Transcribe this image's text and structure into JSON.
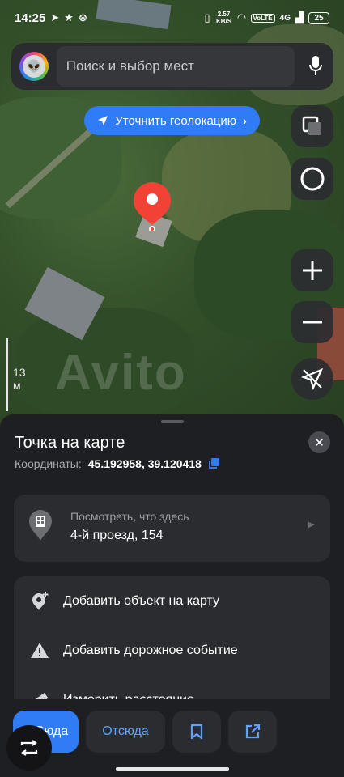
{
  "status_bar": {
    "time": "14:25",
    "net_speed": "2.57 KB/S",
    "volte": "VoLTE",
    "signal": "4G",
    "battery": "25"
  },
  "search": {
    "placeholder": "Поиск и выбор мест"
  },
  "geolocate": {
    "label": "Уточнить геолокацию"
  },
  "map": {
    "scale_label": "13 м",
    "watermark": "Avito"
  },
  "sheet": {
    "title": "Точка на карте",
    "coords_label": "Координаты:",
    "coords_value": "45.192958, 39.120418",
    "here_card": {
      "label": "Посмотреть, что здесь",
      "address": "4-й проезд, 154"
    },
    "actions": [
      {
        "label": "Добавить объект на карту"
      },
      {
        "label": "Добавить дорожное событие"
      },
      {
        "label": "Измерить расстояние"
      }
    ]
  },
  "bottom_bar": {
    "to_label": "Сюда",
    "from_label": "Отсюда"
  },
  "colors": {
    "accent": "#2f7cf6",
    "pin": "#f24236",
    "sheet_bg": "#1e1f22",
    "card_bg": "#2b2c30"
  }
}
